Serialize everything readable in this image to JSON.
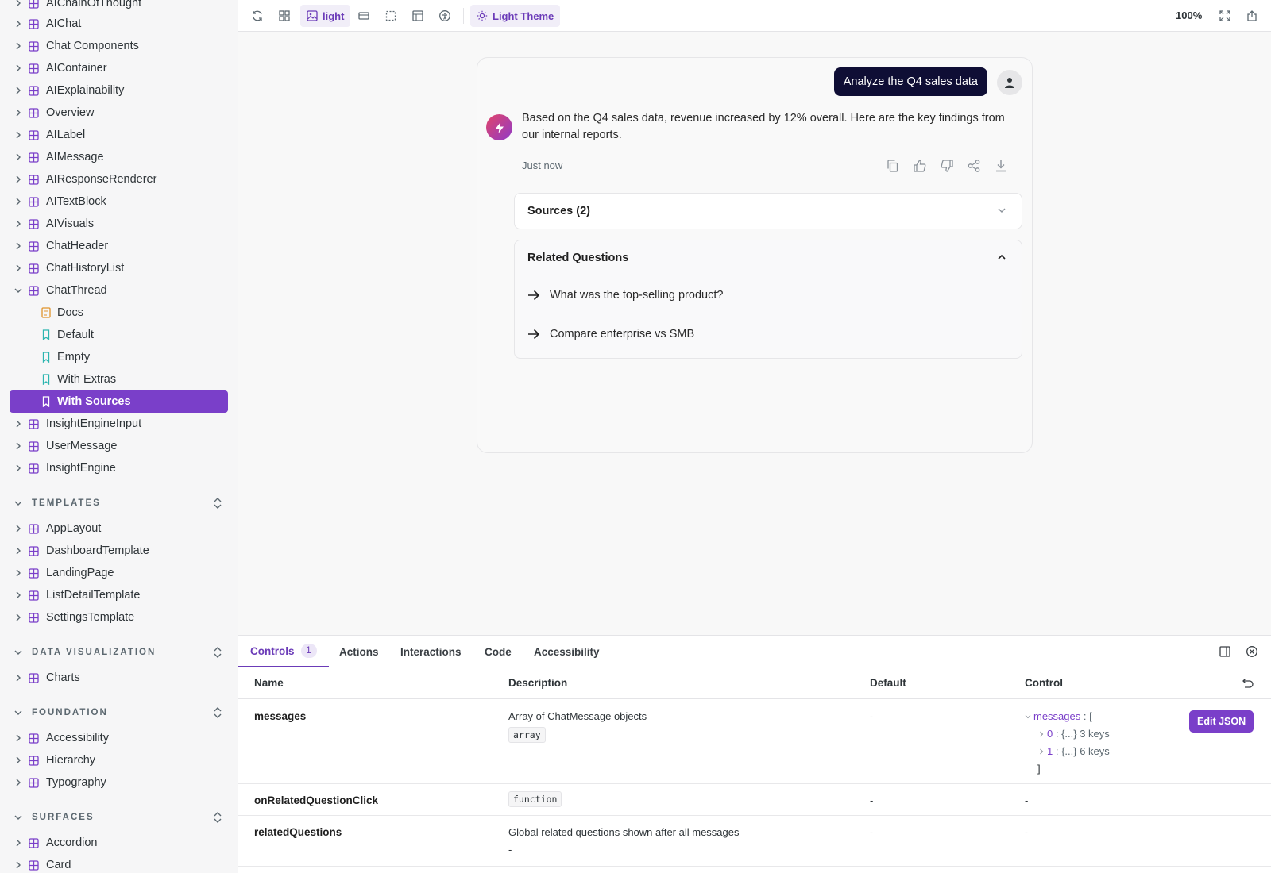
{
  "sidebar": {
    "items": [
      {
        "label": "AIChainOfThought"
      },
      {
        "label": "AIChat"
      },
      {
        "label": "Chat Components"
      },
      {
        "label": "AIContainer"
      },
      {
        "label": "AIExplainability"
      },
      {
        "label": "Overview"
      },
      {
        "label": "AILabel"
      },
      {
        "label": "AIMessage"
      },
      {
        "label": "AIResponseRenderer"
      },
      {
        "label": "AITextBlock"
      },
      {
        "label": "AIVisuals"
      },
      {
        "label": "ChatHeader"
      },
      {
        "label": "ChatHistoryList"
      },
      {
        "label": "ChatThread"
      }
    ],
    "chatthread_children": [
      {
        "label": "Docs"
      },
      {
        "label": "Default"
      },
      {
        "label": "Empty"
      },
      {
        "label": "With Extras"
      },
      {
        "label": "With Sources"
      }
    ],
    "items_after": [
      {
        "label": "InsightEngineInput"
      },
      {
        "label": "UserMessage"
      },
      {
        "label": "InsightEngine"
      }
    ],
    "sections": {
      "templates": {
        "title": "TEMPLATES",
        "items": [
          "AppLayout",
          "DashboardTemplate",
          "LandingPage",
          "ListDetailTemplate",
          "SettingsTemplate"
        ]
      },
      "dataviz": {
        "title": "DATA VISUALIZATION",
        "items": [
          "Charts"
        ]
      },
      "foundation": {
        "title": "FOUNDATION",
        "items": [
          "Accessibility",
          "Hierarchy",
          "Typography"
        ]
      },
      "surfaces": {
        "title": "SURFACES",
        "items": [
          "Accordion",
          "Card"
        ]
      }
    }
  },
  "toolbar": {
    "background_label": "light",
    "theme_label": "Light Theme",
    "zoom": "100%"
  },
  "chat": {
    "user_message": "Analyze the Q4 sales data",
    "ai_message": "Based on the Q4 sales data, revenue increased by 12% overall. Here are the key findings from our internal reports.",
    "timestamp": "Just now",
    "sources_label": "Sources (2)",
    "related_label": "Related Questions",
    "related": [
      "What was the top-selling product?",
      "Compare enterprise vs SMB"
    ]
  },
  "panel": {
    "tabs": [
      "Controls",
      "Actions",
      "Interactions",
      "Code",
      "Accessibility"
    ],
    "controls_badge": "1",
    "headers": {
      "name": "Name",
      "description": "Description",
      "default": "Default",
      "control": "Control"
    },
    "rows": [
      {
        "name": "messages",
        "description": "Array of ChatMessage objects",
        "type": "array",
        "default": "-"
      },
      {
        "name": "onRelatedQuestionClick",
        "description": "",
        "type": "function",
        "default": "-",
        "control": "-"
      },
      {
        "name": "relatedQuestions",
        "description": "Global related questions shown after all messages",
        "type": "-",
        "default": "-",
        "control": "-"
      }
    ],
    "json_tree": {
      "root": "messages",
      "open": "[",
      "item0_key": "0",
      "item0_val": "{...} 3 keys",
      "item1_key": "1",
      "item1_val": "{...} 6 keys",
      "close": "]"
    },
    "edit_json_label": "Edit JSON"
  },
  "colors": {
    "accent": "#7a3fc9",
    "user_bubble": "#0f0e35",
    "component_icon": "#7a3fc9",
    "story_icon": "#2bb5b0",
    "docs_icon": "#e0932b"
  }
}
